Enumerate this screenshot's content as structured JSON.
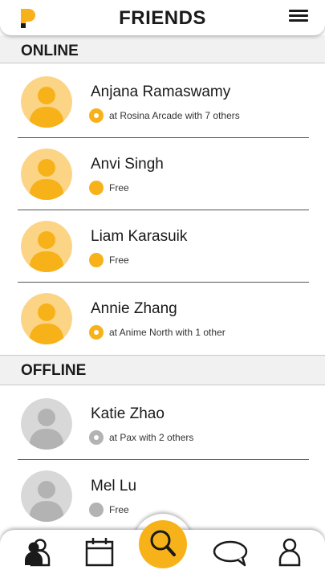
{
  "header": {
    "title": "FRIENDS",
    "logo_icon": "logo-p-icon",
    "menu_icon": "hamburger-menu-icon"
  },
  "colors": {
    "accent": "#f7b21a",
    "accent_light": "#fbd486",
    "offline": "#b3b3b3",
    "offline_light": "#d8d8d8"
  },
  "sections": {
    "online": {
      "label": "ONLINE",
      "friends": [
        {
          "name": "Anjana Ramaswamy",
          "status": "at Rosina Arcade with 7 others",
          "dot": "ring"
        },
        {
          "name": "Anvi Singh",
          "status": "Free",
          "dot": "solid"
        },
        {
          "name": "Liam Karasuik",
          "status": "Free",
          "dot": "solid"
        },
        {
          "name": "Annie Zhang",
          "status": "at Anime North with 1 other",
          "dot": "ring"
        }
      ]
    },
    "offline": {
      "label": "OFFLINE",
      "friends": [
        {
          "name": "Katie Zhao",
          "status": "at Pax with 2 others",
          "dot": "ring"
        },
        {
          "name": "Mel Lu",
          "status": "Free",
          "dot": "solid"
        }
      ]
    }
  },
  "bottom_nav": [
    {
      "icon": "friends-icon"
    },
    {
      "icon": "calendar-icon"
    },
    {
      "icon": "search-icon"
    },
    {
      "icon": "chat-bubble-icon"
    },
    {
      "icon": "profile-icon"
    }
  ]
}
